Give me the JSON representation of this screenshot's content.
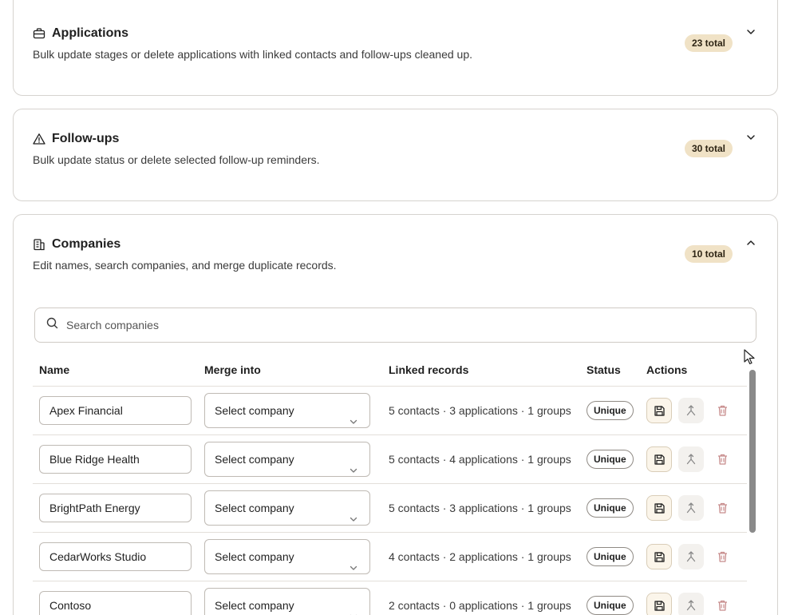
{
  "sections": {
    "applications": {
      "title": "Applications",
      "description": "Bulk update stages or delete applications with linked contacts and follow-ups cleaned up.",
      "count_badge": "23 total",
      "icon": "briefcase-icon",
      "expanded": false
    },
    "followups": {
      "title": "Follow-ups",
      "description": "Bulk update status or delete selected follow-up reminders.",
      "count_badge": "30 total",
      "icon": "warning-triangle-icon",
      "expanded": false
    },
    "companies": {
      "title": "Companies",
      "description": "Edit names, search companies, and merge duplicate records.",
      "count_badge": "10 total",
      "icon": "building-icon",
      "expanded": true,
      "search": {
        "placeholder": "Search companies"
      },
      "columns": {
        "name": "Name",
        "merge": "Merge into",
        "linked": "Linked records",
        "status": "Status",
        "actions": "Actions"
      },
      "rows": [
        {
          "name": "Apex Financial",
          "merge": "Select company",
          "linked": "5 contacts · 3 applications · 1 groups",
          "status": "Unique"
        },
        {
          "name": "Blue Ridge Health",
          "merge": "Select company",
          "linked": "5 contacts · 4 applications · 1 groups",
          "status": "Unique"
        },
        {
          "name": "BrightPath Energy",
          "merge": "Select company",
          "linked": "5 contacts · 3 applications · 1 groups",
          "status": "Unique"
        },
        {
          "name": "CedarWorks Studio",
          "merge": "Select company",
          "linked": "4 contacts · 2 applications · 1 groups",
          "status": "Unique"
        },
        {
          "name": "Contoso",
          "merge": "Select company",
          "linked": "2 contacts · 0 applications · 1 groups",
          "status": "Unique"
        }
      ]
    }
  },
  "colors": {
    "badge_bg": "#f0e2c6",
    "save_bg": "#fbf5ea",
    "delete": "#c78c8c",
    "border": "#d6d3cf"
  }
}
